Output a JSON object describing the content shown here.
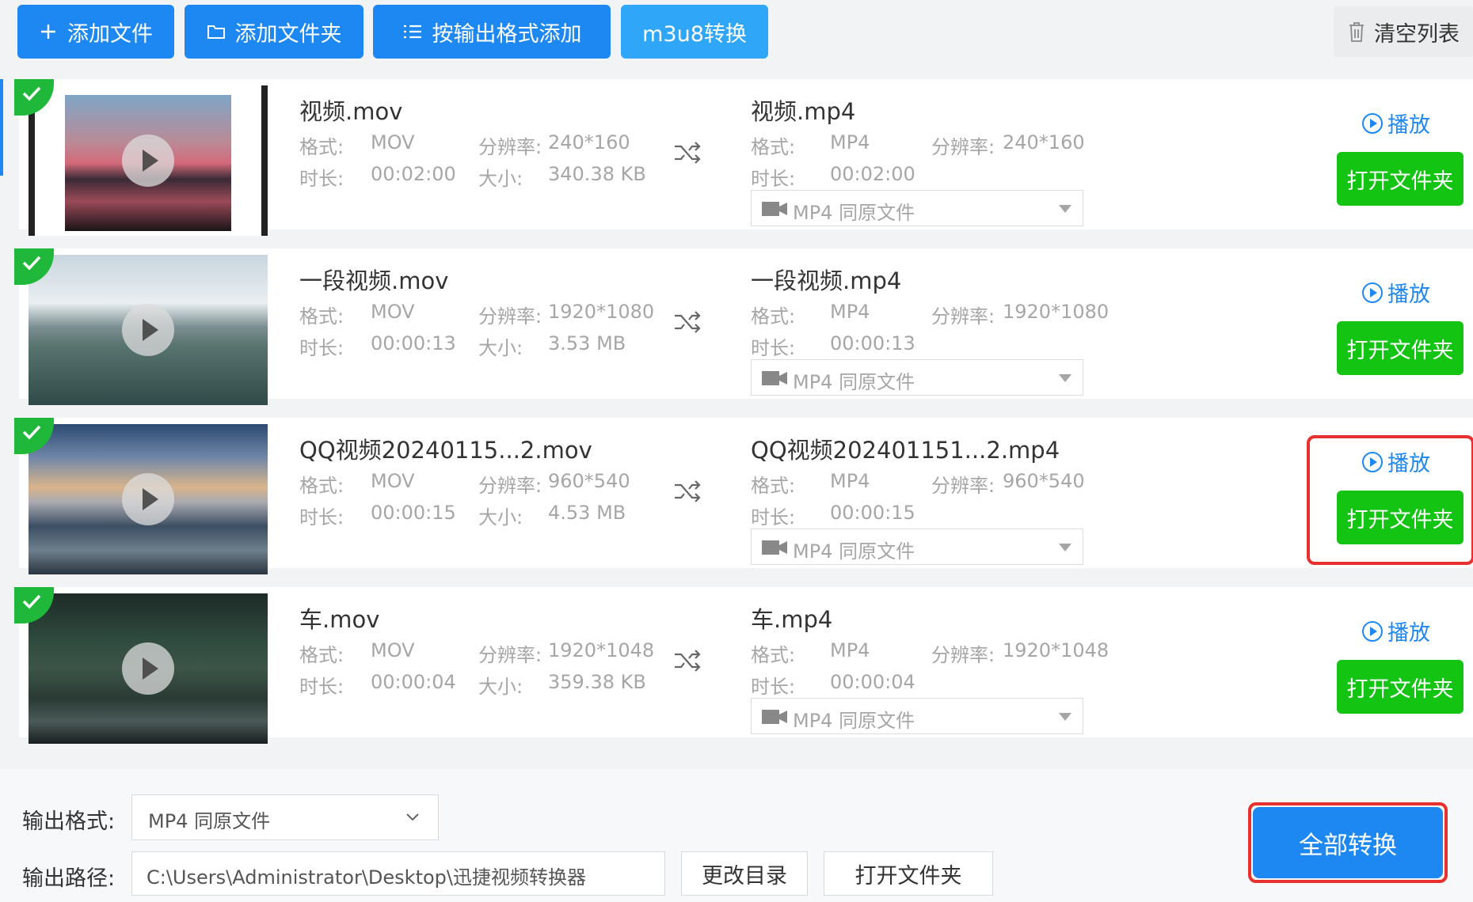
{
  "toolbar": {
    "add_file": "添加文件",
    "add_folder": "添加文件夹",
    "add_by_format": "按输出格式添加",
    "m3u8": "m3u8转换",
    "clear_list": "清空列表"
  },
  "labels": {
    "format": "格式:",
    "resolution": "分辨率:",
    "duration": "时长:",
    "size": "大小:",
    "play": "播放",
    "open_folder": "打开文件夹"
  },
  "files": [
    {
      "src_name": "视频.mov",
      "src_format": "MOV",
      "src_resolution": "240*160",
      "src_duration": "00:02:00",
      "src_size": "340.38 KB",
      "out_name": "视频.mp4",
      "out_format": "MP4",
      "out_resolution": "240*160",
      "out_duration": "00:02:00",
      "out_preset": "MP4  同原文件"
    },
    {
      "src_name": "一段视频.mov",
      "src_format": "MOV",
      "src_resolution": "1920*1080",
      "src_duration": "00:00:13",
      "src_size": "3.53 MB",
      "out_name": "一段视频.mp4",
      "out_format": "MP4",
      "out_resolution": "1920*1080",
      "out_duration": "00:00:13",
      "out_preset": "MP4  同原文件"
    },
    {
      "src_name": "QQ视频20240115...2.mov",
      "src_format": "MOV",
      "src_resolution": "960*540",
      "src_duration": "00:00:15",
      "src_size": "4.53 MB",
      "out_name": "QQ视频202401151...2.mp4",
      "out_format": "MP4",
      "out_resolution": "960*540",
      "out_duration": "00:00:15",
      "out_preset": "MP4  同原文件"
    },
    {
      "src_name": "车.mov",
      "src_format": "MOV",
      "src_resolution": "1920*1048",
      "src_duration": "00:00:04",
      "src_size": "359.38 KB",
      "out_name": "车.mp4",
      "out_format": "MP4",
      "out_resolution": "1920*1048",
      "out_duration": "00:00:04",
      "out_preset": "MP4  同原文件"
    }
  ],
  "bottom": {
    "output_format_label": "输出格式:",
    "output_format_value": "MP4  同原文件",
    "output_path_label": "输出路径:",
    "output_path_value": "C:\\Users\\Administrator\\Desktop\\迅捷视频转换器",
    "change_dir": "更改目录",
    "open_folder": "打开文件夹",
    "convert_all": "全部转换"
  },
  "colors": {
    "primary": "#1e88f2",
    "success": "#13c413",
    "highlight": "#e8302e"
  }
}
